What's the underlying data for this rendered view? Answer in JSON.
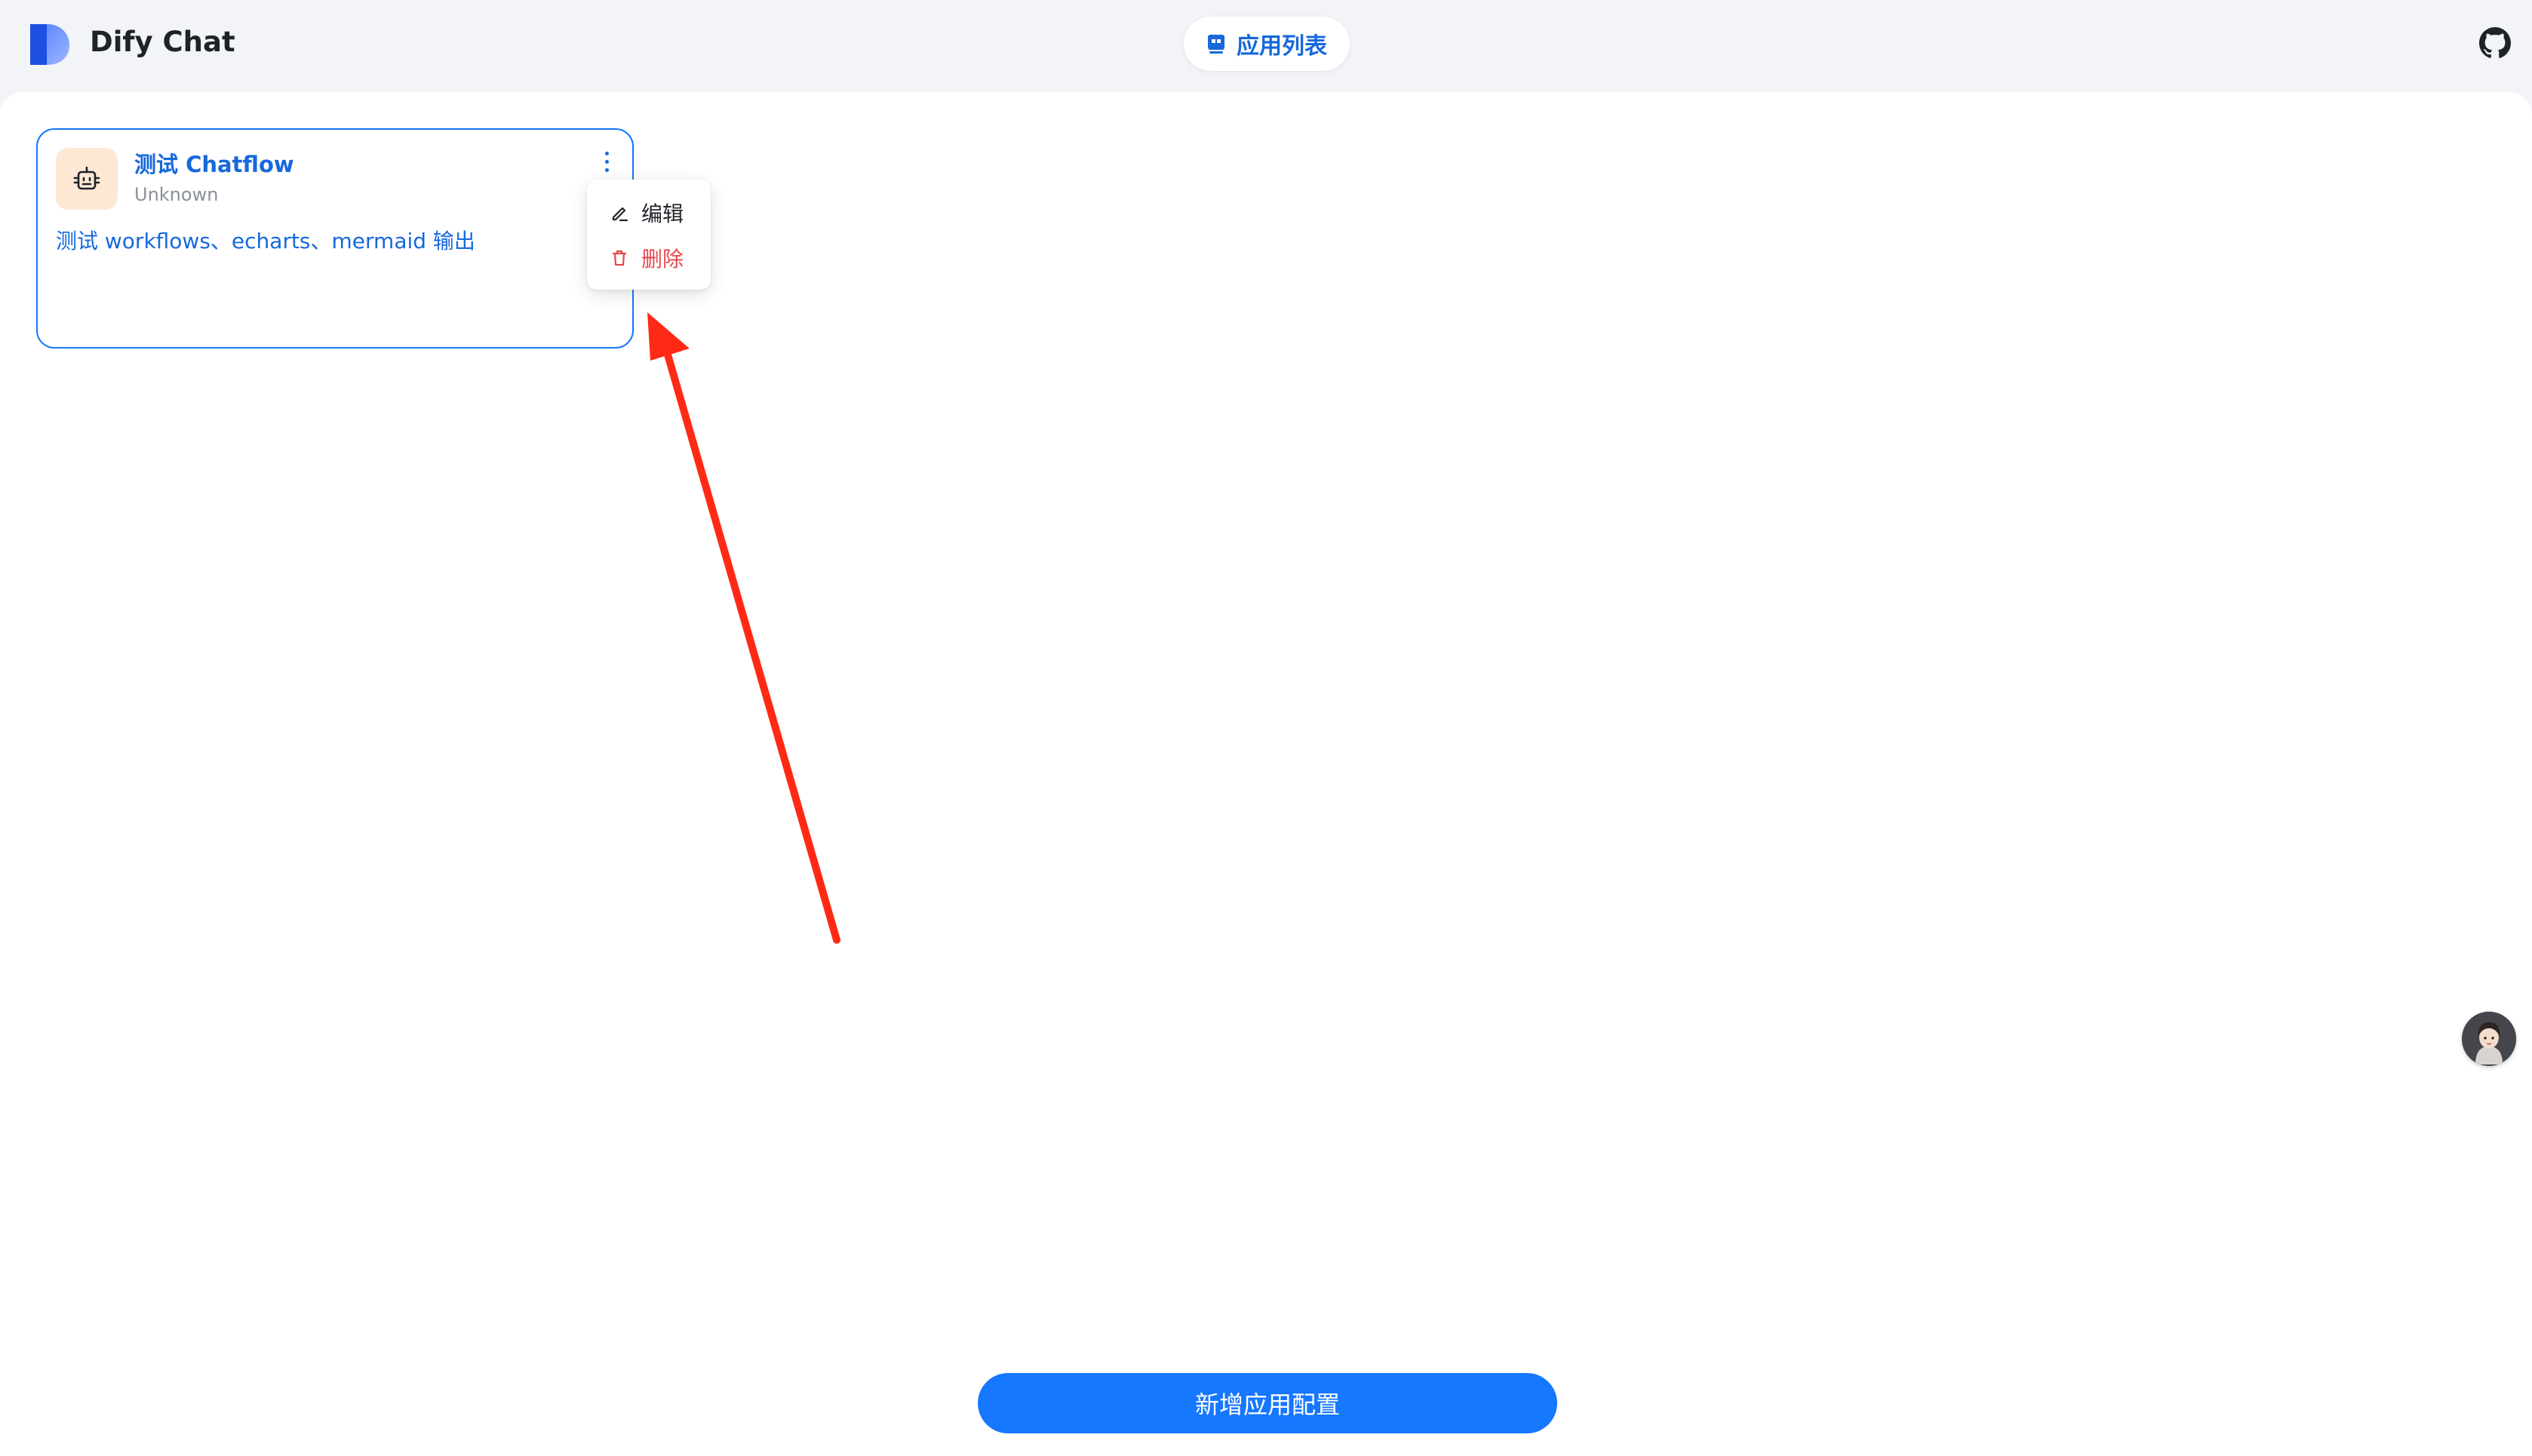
{
  "header": {
    "title": "Dify Chat",
    "nav_label": "应用列表"
  },
  "app_card": {
    "name": "测试 Chatflow",
    "subtitle": "Unknown",
    "description": "测试 workflows、echarts、mermaid 输出"
  },
  "menu": {
    "edit_label": "编辑",
    "delete_label": "删除"
  },
  "footer": {
    "add_button_label": "新增应用配置"
  },
  "colors": {
    "accent": "#1677ff",
    "danger": "#e5484d",
    "card_icon_bg": "#fde8d4",
    "annotation_arrow": "#ff2a16"
  },
  "icons": [
    "app-logo",
    "app-list-icon",
    "github-icon",
    "robot-icon",
    "more-vertical-icon",
    "edit-pencil-icon",
    "trash-icon",
    "avatar"
  ]
}
